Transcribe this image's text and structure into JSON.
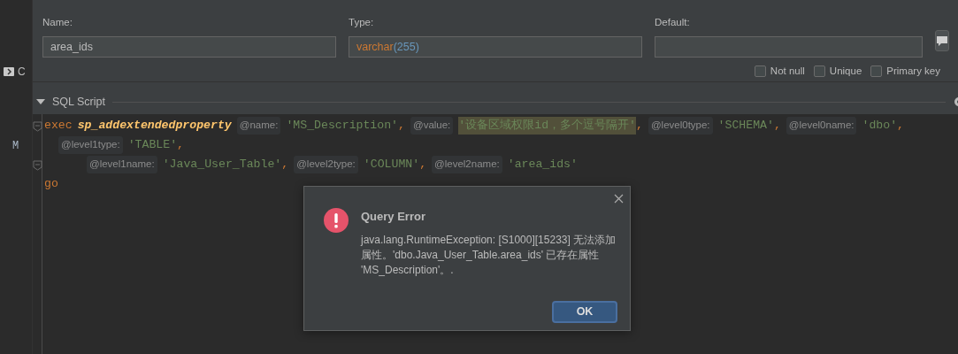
{
  "sidebar": {
    "items": [
      {
        "text": "C",
        "kind": "tab"
      },
      {
        "text": "M",
        "kind": "cell"
      }
    ]
  },
  "fields": [
    {
      "label": "Name:",
      "value_parts": [
        {
          "text": "area_ids",
          "kind": "plain"
        }
      ]
    },
    {
      "label": "Type:",
      "value_parts": [
        {
          "text": "varchar",
          "kind": "type"
        },
        {
          "text": "(255)",
          "kind": "number"
        }
      ]
    },
    {
      "label": "Default:"
    }
  ],
  "options": [
    {
      "label": "Not null",
      "checked": false
    },
    {
      "label": "Unique",
      "checked": false
    },
    {
      "label": "Primary key",
      "checked": false
    }
  ],
  "section": {
    "title": "SQL Script",
    "expanded": true
  },
  "code_lines": [
    {
      "tokens": [
        {
          "kind": "keyword",
          "text": "exec"
        },
        {
          "kind": "proc",
          "text": "sp_addextendedproperty"
        },
        {
          "kind": "hint",
          "text": "@name:"
        },
        {
          "kind": "string",
          "text": "'MS_Description'"
        },
        {
          "kind": "punct",
          "text": ","
        },
        {
          "kind": "hint",
          "text": "@value:"
        },
        {
          "kind": "string",
          "text": "'设备区域权限id，多个逗号隔开'",
          "highlighted": true
        },
        {
          "kind": "punct",
          "text": ","
        },
        {
          "kind": "hint",
          "text": "@level0type:"
        },
        {
          "kind": "string",
          "text": "'SCHEMA'"
        },
        {
          "kind": "punct",
          "text": ","
        },
        {
          "kind": "hint",
          "text": "@level0name:"
        },
        {
          "kind": "string",
          "text": "'dbo'"
        },
        {
          "kind": "punct",
          "text": ","
        }
      ]
    },
    {
      "tokens": [
        {
          "kind": "hint",
          "text": "@level1type:"
        },
        {
          "kind": "string",
          "text": "'TABLE'"
        },
        {
          "kind": "punct",
          "text": ","
        }
      ]
    },
    {
      "tokens": [
        {
          "kind": "hint",
          "text": "@level1name:"
        },
        {
          "kind": "string",
          "text": "'Java_User_Table'"
        },
        {
          "kind": "punct",
          "text": ","
        },
        {
          "kind": "hint",
          "text": "@level2type:"
        },
        {
          "kind": "string",
          "text": "'COLUMN'"
        },
        {
          "kind": "punct",
          "text": ","
        },
        {
          "kind": "hint",
          "text": "@level2name:"
        },
        {
          "kind": "string",
          "text": "'area_ids'"
        }
      ]
    },
    {
      "tokens": [
        {
          "kind": "keyword",
          "text": "go"
        }
      ]
    }
  ],
  "dialog": {
    "title": "Query Error",
    "message": "java.lang.RuntimeException: [S1000][15233] 无法添加属性。'dbo.Java_User_Table.area_ids' 已存在属性 'MS_Description'。.",
    "buttons": [
      {
        "label": "OK",
        "selected": true
      }
    ]
  }
}
